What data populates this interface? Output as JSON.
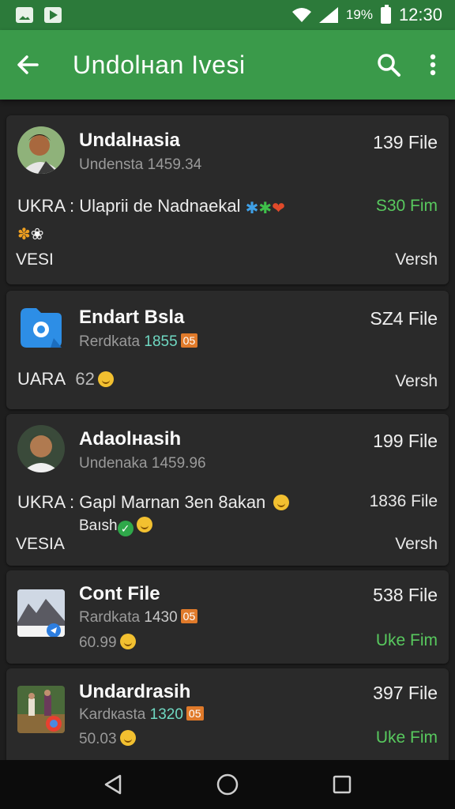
{
  "status": {
    "battery_text": "19%",
    "time": "12:30"
  },
  "app_bar": {
    "title": "Undolнan Ivesi"
  },
  "colors": {
    "app_bar": "#3a9a4a",
    "status_bar": "#2c7a3a",
    "accent_green": "#58c95e",
    "background": "#1e1e1e",
    "card": "#2a2a2a"
  },
  "items": [
    {
      "name": "Undalнasia",
      "subtitle": "Undensta 1459.34",
      "count": "139 File",
      "line": "UKRA : Ulaprii  de Nadnaekal",
      "right_text": "S30 Fim",
      "foot_left": "VESI",
      "foot_right": "Versh"
    },
    {
      "name": "Endart Bsla",
      "subtitle_prefix": "Rerdkata",
      "subtitle_hl": "1855",
      "chip": "05",
      "count": "SZ4 File",
      "line": "UARA",
      "line_extra": "62",
      "foot_right": "Versh"
    },
    {
      "name": "Adaolнasih",
      "subtitle": "Undenaka 1459.96",
      "count": "199 File",
      "line": "UKRA : Gapl Marnan 3en 8akan",
      "line2": "Baısh",
      "right_text": "1836 File",
      "foot_left": "VESIA",
      "foot_right": "Versh"
    },
    {
      "name": "Cont File",
      "subtitle_prefix": "Rardkata",
      "subtitle_hl": "1430",
      "chip": "05",
      "count": "538 File",
      "line": "60.99",
      "foot_right": "Uke Fim"
    },
    {
      "name": "Undardrasih",
      "subtitle_prefix": "Kardкasta",
      "subtitle_hl": "1320",
      "chip": "05",
      "count": "397 File",
      "line": "50.03",
      "foot_right": "Uke Fim"
    }
  ]
}
